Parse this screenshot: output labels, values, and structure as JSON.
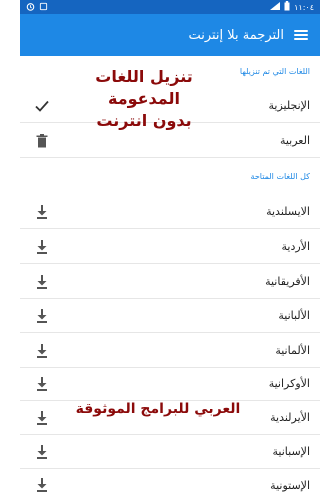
{
  "status_bar": {
    "time": "١١:٠٤",
    "battery_icon": "battery-icon",
    "signal_icon": "signal-icon"
  },
  "app_bar": {
    "title": "الترجمة بلا إنترنت",
    "menu_icon": "menu-icon"
  },
  "downloaded_section": {
    "header": "اللغات التي تم تنزيلها",
    "items": [
      {
        "label": "الإنجليزية",
        "action_icon": "checkmark-icon"
      },
      {
        "label": "العربية",
        "action_icon": "trash-icon"
      }
    ]
  },
  "available_section": {
    "header": "كل اللغات المتاحة",
    "items": [
      {
        "label": "الايسلندية",
        "action_icon": "download-icon"
      },
      {
        "label": "الأردية",
        "action_icon": "download-icon"
      },
      {
        "label": "الأفريقانية",
        "action_icon": "download-icon"
      },
      {
        "label": "الألبانية",
        "action_icon": "download-icon"
      },
      {
        "label": "الألمانية",
        "action_icon": "download-icon"
      },
      {
        "label": "الأوكرانية",
        "action_icon": "download-icon"
      },
      {
        "label": "الأيرلندية",
        "action_icon": "download-icon"
      },
      {
        "label": "الإسبانية",
        "action_icon": "download-icon"
      },
      {
        "label": "الإستونية",
        "action_icon": "download-icon"
      }
    ]
  },
  "overlays": {
    "top_text": [
      "تنزيل اللغات",
      "المدعومة",
      "بدون انترنت"
    ],
    "bottom_text": "العربي للبرامج الموثوقة"
  },
  "colors": {
    "primary": "#1e88e5",
    "status_bar": "#1565c0",
    "overlay_text": "#8b0a0a"
  }
}
